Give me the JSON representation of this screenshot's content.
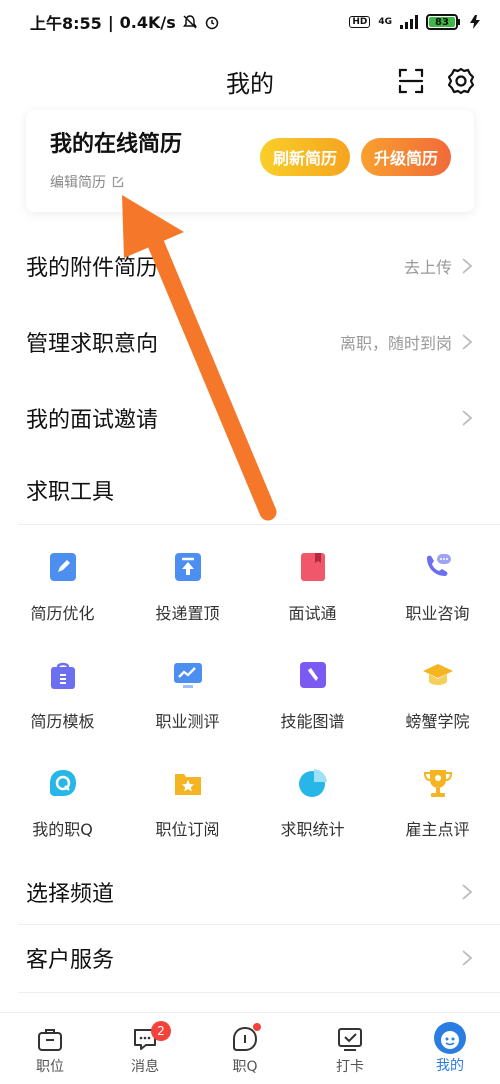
{
  "status": {
    "time": "上午8:55",
    "speed": "0.4K/s",
    "network": "4G",
    "battery": "83"
  },
  "header": {
    "title": "我的"
  },
  "resume_card": {
    "title": "我的在线简历",
    "edit_label": "编辑简历",
    "refresh_label": "刷新简历",
    "upgrade_label": "升级简历"
  },
  "rows": [
    {
      "label": "我的附件简历",
      "extra": "去上传"
    },
    {
      "label": "管理求职意向",
      "extra": "离职，随时到岗"
    },
    {
      "label": "我的面试邀请",
      "extra": ""
    }
  ],
  "tools_section": {
    "title": "求职工具",
    "items": [
      {
        "label": "简历优化",
        "icon": "resume-optimize-icon"
      },
      {
        "label": "投递置顶",
        "icon": "pin-top-icon"
      },
      {
        "label": "面试通",
        "icon": "interview-book-icon"
      },
      {
        "label": "职业咨询",
        "icon": "phone-chat-icon"
      },
      {
        "label": "简历模板",
        "icon": "template-bag-icon"
      },
      {
        "label": "职业测评",
        "icon": "monitor-chart-icon"
      },
      {
        "label": "技能图谱",
        "icon": "skill-map-icon"
      },
      {
        "label": "螃蟹学院",
        "icon": "graduation-cap-icon"
      },
      {
        "label": "我的职Q",
        "icon": "q-bubble-icon"
      },
      {
        "label": "职位订阅",
        "icon": "star-folder-icon"
      },
      {
        "label": "求职统计",
        "icon": "pie-chart-icon"
      },
      {
        "label": "雇主点评",
        "icon": "trophy-icon"
      }
    ]
  },
  "bottom_rows": [
    {
      "label": "选择频道"
    },
    {
      "label": "客户服务"
    }
  ],
  "tabbar": {
    "items": [
      {
        "label": "职位"
      },
      {
        "label": "消息",
        "badge": "2"
      },
      {
        "label": "职Q"
      },
      {
        "label": "打卡"
      },
      {
        "label": "我的"
      }
    ]
  },
  "colors": {
    "accent": "#2a7de1",
    "arrow": "#f5782a",
    "badge": "#f4433c"
  }
}
